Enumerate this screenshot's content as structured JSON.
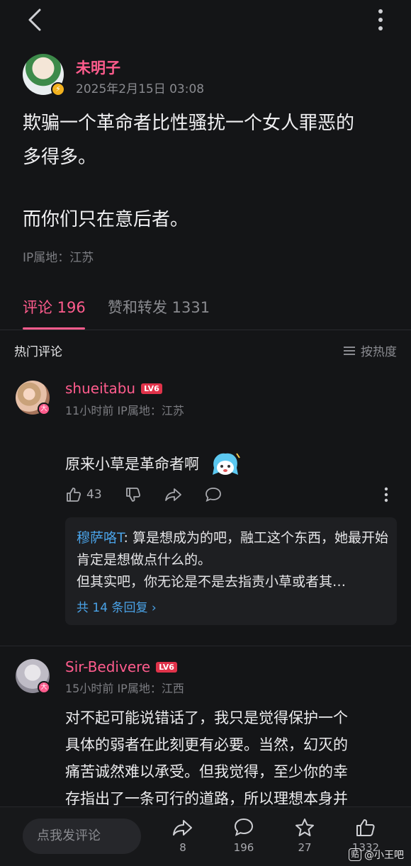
{
  "post": {
    "author": "未明子",
    "time": "2025年2月15日 03:08",
    "paragraph1_line1": "欺骗一个革命者比性骚扰一个女人罪恶的",
    "paragraph1_line2": "多得多。",
    "paragraph2": "而你们只在意后者。",
    "ip": "IP属地：江苏"
  },
  "tabs": {
    "comments": "评论 196",
    "likes": "赞和转发 1331"
  },
  "section": {
    "hot": "热门评论",
    "sort": "按热度"
  },
  "comments": [
    {
      "user": "shueitabu",
      "level": "LV6",
      "badge": "大",
      "meta": "11小时前 IP属地：江苏",
      "text": "原来小草是革命者啊",
      "likes": "43",
      "reply": {
        "user": "穆萨咯T",
        "text": "算是想成为的吧，融工这个东西，她最开始肯定是想做点什么的。",
        "line3": "但其实吧，你无论是不是去指责小草或者其…",
        "more": "共 14 条回复"
      }
    },
    {
      "user": "Sir-Bedivere",
      "level": "LV6",
      "badge": "大",
      "meta": "15小时前 IP属地：江西",
      "line1": "对不起可能说错话了，我只是觉得保护一个",
      "line2": "具体的弱者在此刻更有必要。当然，幻灭的",
      "line3": "痛苦诚然难以承受。但我觉得，至少你的幸",
      "line4": "存指出了一条可行的道路，所以理想本身并"
    }
  ],
  "bottom": {
    "placeholder": "点我发评论",
    "share": "8",
    "comment": "196",
    "favorite": "27",
    "like": "1332"
  },
  "watermark": {
    "icon": "贴",
    "text": "@小王吧"
  },
  "colors": {
    "accent": "#ff5c8d",
    "link": "#4aa3e8",
    "background": "#141517"
  }
}
